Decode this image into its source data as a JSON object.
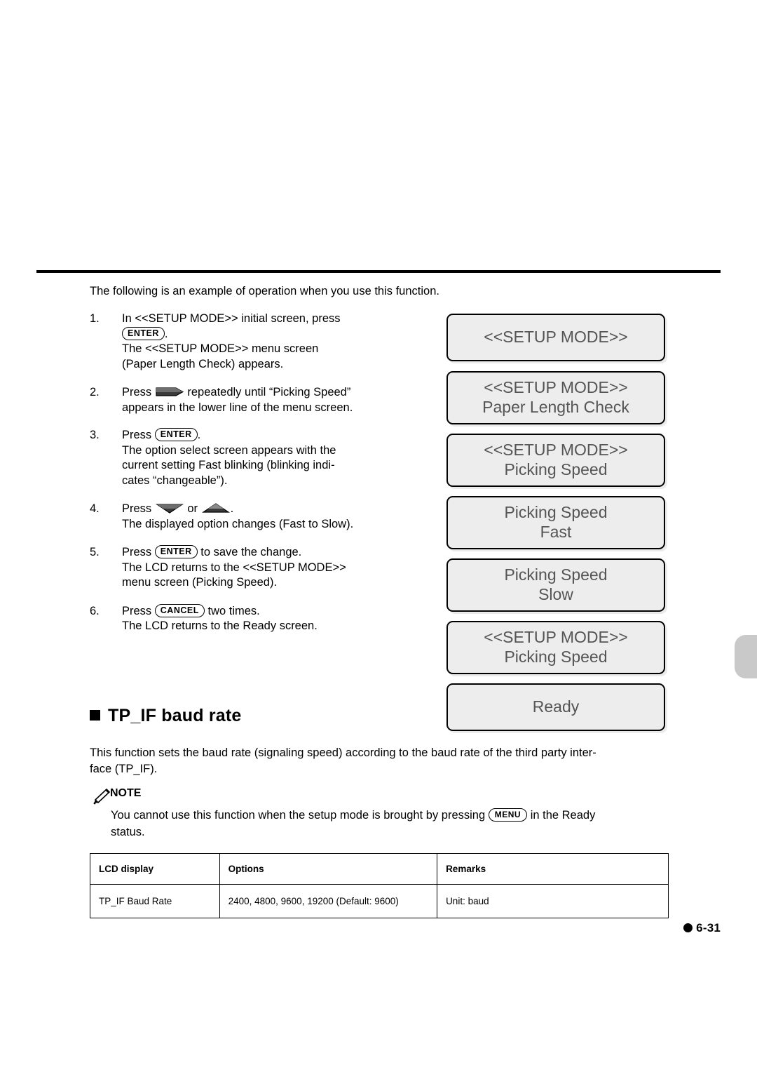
{
  "intro": "The following is an example of operation when you use this function.",
  "steps": [
    {
      "num": "1.",
      "lines": [
        {
          "pre": "In <<SETUP MODE>> initial screen, press",
          "key": null,
          "post": ""
        },
        {
          "pre": "",
          "key": "ENTER",
          "post": "."
        },
        {
          "pre": "The <<SETUP MODE>> menu screen",
          "key": null,
          "post": ""
        },
        {
          "pre": "(Paper Length Check) appears.",
          "key": null,
          "post": ""
        }
      ]
    },
    {
      "num": "2.",
      "lines": [
        {
          "pre": "Press",
          "icon": "right-arrow-button",
          "post": "repeatedly until “Picking Speed”"
        },
        {
          "pre": "appears in the lower line of the menu screen.",
          "post": ""
        }
      ]
    },
    {
      "num": "3.",
      "lines": [
        {
          "pre": "Press",
          "key": "ENTER",
          "post": "."
        },
        {
          "pre": "The option select screen appears with the",
          "post": ""
        },
        {
          "pre": "current setting Fast blinking (blinking indi-",
          "post": ""
        },
        {
          "pre": "cates “changeable”).",
          "post": ""
        }
      ]
    },
    {
      "num": "4.",
      "lines": [
        {
          "pre": "Press",
          "icon": "down-arrow-button",
          "mid": "or",
          "icon2": "up-arrow-button",
          "post": "."
        },
        {
          "pre": "The displayed option changes (Fast to Slow).",
          "post": ""
        }
      ]
    },
    {
      "num": "5.",
      "lines": [
        {
          "pre": "Press",
          "key": "ENTER",
          "post": "to save the change."
        },
        {
          "pre": "The LCD returns to the <<SETUP MODE>>",
          "post": ""
        },
        {
          "pre": "menu screen (Picking Speed).",
          "post": ""
        }
      ]
    },
    {
      "num": "6.",
      "lines": [
        {
          "pre": "Press",
          "key": "CANCEL",
          "post": "two times."
        },
        {
          "pre": "The LCD returns to the Ready screen.",
          "post": ""
        }
      ]
    }
  ],
  "step_text": {
    "s1_l1": "In <<SETUP MODE>> initial screen, press",
    "s1_l2_post": ".",
    "s1_l3": "The <<SETUP MODE>> menu screen",
    "s1_l4": "(Paper Length Check) appears.",
    "s2_pre": "Press",
    "s2_post": "repeatedly until “Picking Speed”",
    "s2_l2": "appears in the lower line of the menu screen.",
    "s3_pre": "Press",
    "s3_post": ".",
    "s3_l2": "The option select screen appears with the",
    "s3_l3": "current setting Fast blinking (blinking indi-",
    "s3_l4": "cates “changeable”).",
    "s4_pre": "Press",
    "s4_mid": "or",
    "s4_post": ".",
    "s4_l2": "The displayed option changes (Fast to Slow).",
    "s5_pre": "Press",
    "s5_post": "to save the change.",
    "s5_l2": "The LCD returns to the <<SETUP MODE>>",
    "s5_l3": "menu screen (Picking Speed).",
    "s6_pre": "Press",
    "s6_post": "two times.",
    "s6_l2": "The LCD returns to the Ready screen.",
    "num1": "1.",
    "num2": "2.",
    "num3": "3.",
    "num4": "4.",
    "num5": "5.",
    "num6": "6."
  },
  "keys": {
    "enter": "ENTER",
    "cancel": "CANCEL",
    "menu": "MENU"
  },
  "lcd_screens": [
    {
      "line1": "<<SETUP MODE>>",
      "line2": ""
    },
    {
      "line1": "<<SETUP MODE>>",
      "line2": "Paper Length Check"
    },
    {
      "line1": "<<SETUP MODE>>",
      "line2": "Picking Speed"
    },
    {
      "line1": "Picking Speed",
      "line2": "Fast"
    },
    {
      "line1": "Picking Speed",
      "line2": "Slow"
    },
    {
      "line1": "<<SETUP MODE>>",
      "line2": "Picking Speed"
    },
    {
      "line1": "Ready",
      "line2": ""
    }
  ],
  "section": {
    "heading": "TP_IF baud rate",
    "paragraph_l1": "This function sets the baud rate (signaling speed) according to the baud rate of the third party inter-",
    "paragraph_l2": "face (TP_IF)."
  },
  "note": {
    "label": "NOTE",
    "text_pre": "You cannot use this function when the setup mode is brought by pressing",
    "text_post": "in the Ready",
    "text_l2": "status."
  },
  "table": {
    "headers": [
      "LCD display",
      "Options",
      "Remarks"
    ],
    "rows": [
      [
        "TP_IF Baud Rate",
        "2400, 4800, 9600, 19200 (Default: 9600)",
        "Unit:  baud"
      ]
    ]
  },
  "page_number": "6-31"
}
